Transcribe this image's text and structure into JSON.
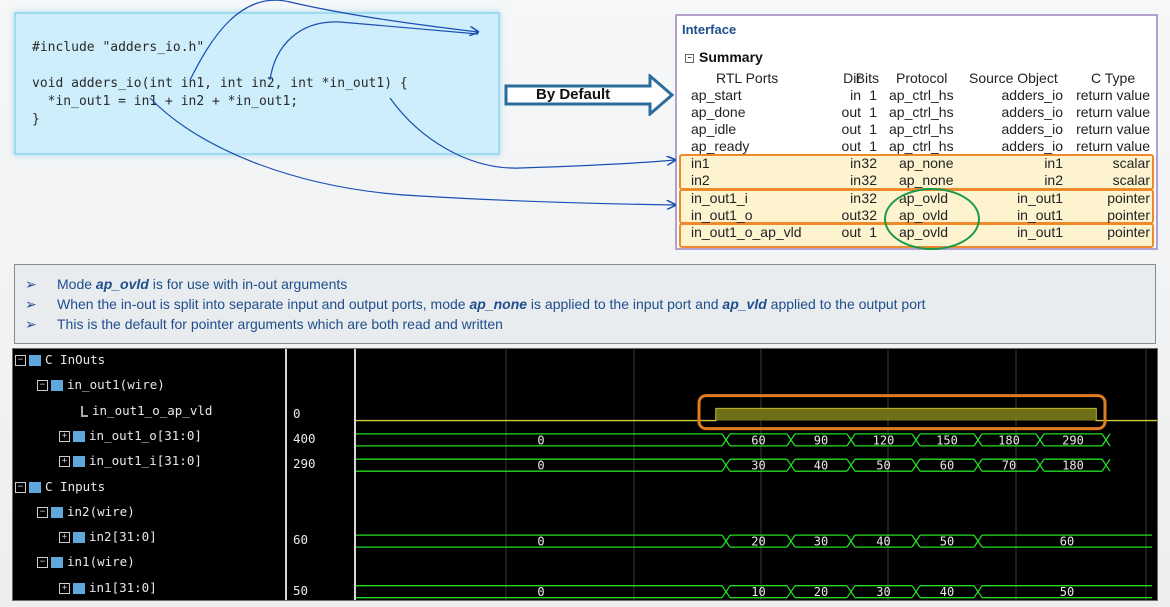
{
  "code": {
    "lines": [
      "#include \"adders_io.h\"",
      "",
      "void adders_io(int in1, int in2, int *in_out1) {",
      "  *in_out1 = in1 + in2 + *in_out1;",
      "}"
    ]
  },
  "callout": {
    "label": "By Default"
  },
  "interface": {
    "title": "Interface",
    "summary_label": "Summary",
    "columns": [
      "RTL Ports",
      "Dir",
      "Bits",
      "Protocol",
      "Source Object",
      "C Type"
    ],
    "rows": [
      {
        "port": "ap_start",
        "dir": "in",
        "bits": "1",
        "protocol": "ap_ctrl_hs",
        "source": "adders_io",
        "ctype": "return value"
      },
      {
        "port": "ap_done",
        "dir": "out",
        "bits": "1",
        "protocol": "ap_ctrl_hs",
        "source": "adders_io",
        "ctype": "return value"
      },
      {
        "port": "ap_idle",
        "dir": "out",
        "bits": "1",
        "protocol": "ap_ctrl_hs",
        "source": "adders_io",
        "ctype": "return value"
      },
      {
        "port": "ap_ready",
        "dir": "out",
        "bits": "1",
        "protocol": "ap_ctrl_hs",
        "source": "adders_io",
        "ctype": "return value"
      },
      {
        "port": "in1",
        "dir": "in",
        "bits": "32",
        "protocol": "ap_none",
        "source": "in1",
        "ctype": "scalar"
      },
      {
        "port": "in2",
        "dir": "in",
        "bits": "32",
        "protocol": "ap_none",
        "source": "in2",
        "ctype": "scalar"
      },
      {
        "port": "in_out1_i",
        "dir": "in",
        "bits": "32",
        "protocol": "ap_ovld",
        "source": "in_out1",
        "ctype": "pointer"
      },
      {
        "port": "in_out1_o",
        "dir": "out",
        "bits": "32",
        "protocol": "ap_ovld",
        "source": "in_out1",
        "ctype": "pointer"
      },
      {
        "port": "in_out1_o_ap_vld",
        "dir": "out",
        "bits": "1",
        "protocol": "ap_ovld",
        "source": "in_out1",
        "ctype": "pointer"
      }
    ]
  },
  "notes": [
    {
      "parts": [
        {
          "t": "Mode "
        },
        {
          "t": "ap_ovld",
          "em": true
        },
        {
          "t": " is for use with in-out arguments"
        }
      ]
    },
    {
      "parts": [
        {
          "t": "When the in-out is split into separate input and output ports, mode "
        },
        {
          "t": "ap_none",
          "em": true
        },
        {
          "t": " is applied to the input port and "
        },
        {
          "t": "ap_vld",
          "em": true
        },
        {
          "t": " applied to the output port"
        }
      ]
    },
    {
      "parts": [
        {
          "t": "This is the default for pointer arguments which are both read and written"
        }
      ]
    }
  ],
  "bullet_glyph": "➢",
  "waveform": {
    "signals": [
      {
        "label": "C InOuts",
        "level": 0,
        "kind": "group",
        "value": ""
      },
      {
        "label": "in_out1(wire)",
        "level": 1,
        "kind": "group",
        "value": ""
      },
      {
        "label": "in_out1_o_ap_vld",
        "level": 2,
        "kind": "wire",
        "value": "0"
      },
      {
        "label": "in_out1_o[31:0]",
        "level": 2,
        "kind": "bus",
        "value": "400"
      },
      {
        "label": "in_out1_i[31:0]",
        "level": 2,
        "kind": "bus",
        "value": "290"
      },
      {
        "label": "C Inputs",
        "level": 0,
        "kind": "group",
        "value": ""
      },
      {
        "label": "in2(wire)",
        "level": 1,
        "kind": "group",
        "value": ""
      },
      {
        "label": "in2[31:0]",
        "level": 2,
        "kind": "bus",
        "value": "60"
      },
      {
        "label": "in1(wire)",
        "level": 1,
        "kind": "group",
        "value": ""
      },
      {
        "label": "in1[31:0]",
        "level": 2,
        "kind": "bus",
        "value": "50"
      }
    ],
    "traces": {
      "in_out1_o": [
        "0",
        "60",
        "90",
        "120",
        "150",
        "180",
        "290"
      ],
      "in_out1_i": [
        "0",
        "30",
        "40",
        "50",
        "60",
        "70",
        "180"
      ],
      "in2": [
        "0",
        "20",
        "30",
        "40",
        "50",
        "60"
      ],
      "in1": [
        "0",
        "10",
        "20",
        "30",
        "40",
        "50"
      ]
    },
    "colors": {
      "wave": "#22dd22",
      "bus_text": "#e8e8e8",
      "highlight": "#e07b20",
      "vld_fill": "#7a7a1a"
    }
  }
}
